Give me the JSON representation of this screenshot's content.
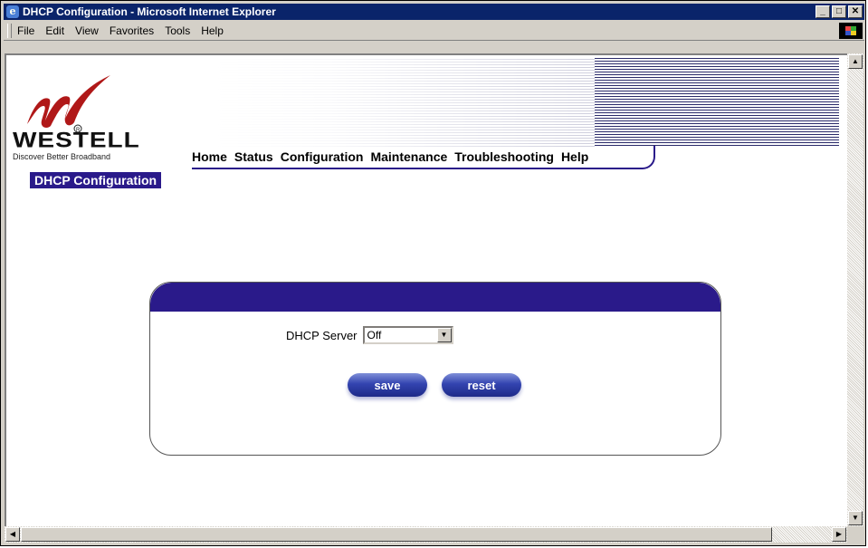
{
  "window": {
    "title": "DHCP Configuration - Microsoft Internet Explorer",
    "controls": [
      "_",
      "□",
      "✕"
    ]
  },
  "menubar": {
    "items": [
      {
        "label": "File",
        "key": "F"
      },
      {
        "label": "Edit",
        "key": "E"
      },
      {
        "label": "View",
        "key": "V"
      },
      {
        "label": "Favorites",
        "key": "a"
      },
      {
        "label": "Tools",
        "key": "T"
      },
      {
        "label": "Help",
        "key": "H"
      }
    ]
  },
  "logo": {
    "word": "WESTELL",
    "tagline": "Discover Better Broadband",
    "colors": {
      "mark": "#b01818",
      "text": "#111111"
    }
  },
  "nav": {
    "items": [
      "Home",
      "Status",
      "Configuration",
      "Maintenance",
      "Troubleshooting",
      "Help"
    ]
  },
  "page": {
    "heading": "DHCP Configuration"
  },
  "form": {
    "dhcp_label": "DHCP Server",
    "dhcp_value": "Off",
    "save_label": "save",
    "reset_label": "reset"
  },
  "colors": {
    "accent": "#2a1a8a",
    "titlebar": "#0a246a",
    "chrome": "#d4d0c8"
  }
}
